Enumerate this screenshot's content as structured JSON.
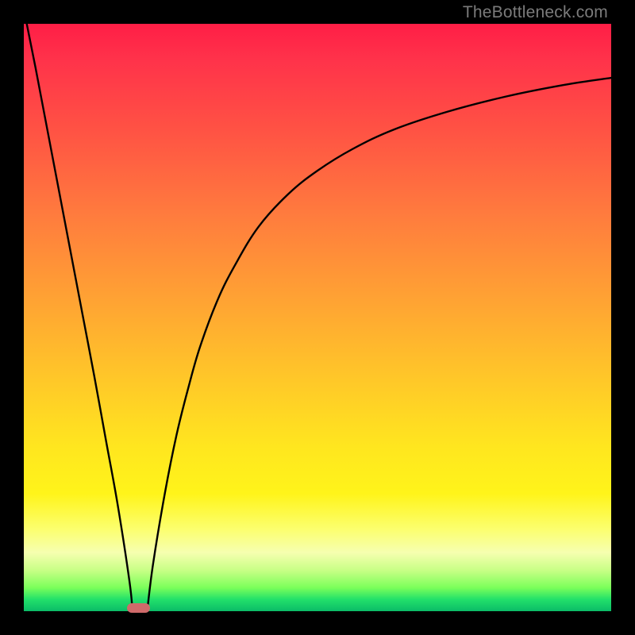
{
  "watermark": "TheBottleneck.com",
  "chart_data": {
    "type": "line",
    "title": "",
    "xlabel": "",
    "ylabel": "",
    "xlim": [
      0,
      100
    ],
    "ylim": [
      0,
      100
    ],
    "grid": false,
    "legend": null,
    "annotations": [],
    "background_gradient": {
      "direction": "vertical_top_to_bottom",
      "stops": [
        {
          "pct": 0,
          "color": "#ff1e46"
        },
        {
          "pct": 32,
          "color": "#ff7a3e"
        },
        {
          "pct": 60,
          "color": "#ffc629"
        },
        {
          "pct": 80,
          "color": "#fff41a"
        },
        {
          "pct": 90,
          "color": "#f6ffb0"
        },
        {
          "pct": 96,
          "color": "#7bff5a"
        },
        {
          "pct": 100,
          "color": "#0bbc68"
        }
      ]
    },
    "series": [
      {
        "name": "left-branch",
        "x": [
          0.5,
          2,
          4,
          6,
          8,
          10,
          12,
          14,
          16,
          18,
          18.5
        ],
        "y": [
          100,
          92.5,
          82,
          71.5,
          61,
          50.5,
          40,
          29,
          18,
          5,
          0
        ]
      },
      {
        "name": "right-branch",
        "x": [
          21,
          22,
          24,
          26,
          28,
          30,
          33,
          36,
          40,
          45,
          50,
          56,
          63,
          72,
          82,
          92,
          100
        ],
        "y": [
          0,
          8,
          20,
          30,
          38,
          45,
          53,
          59,
          65.5,
          71,
          75,
          78.7,
          82,
          85,
          87.6,
          89.6,
          90.8
        ]
      }
    ],
    "marker": {
      "name": "target-pill",
      "shape": "rounded-rect",
      "color": "#cf6a6a",
      "x_range": [
        17.5,
        21.5
      ],
      "y_range": [
        -0.3,
        1.4
      ]
    }
  }
}
